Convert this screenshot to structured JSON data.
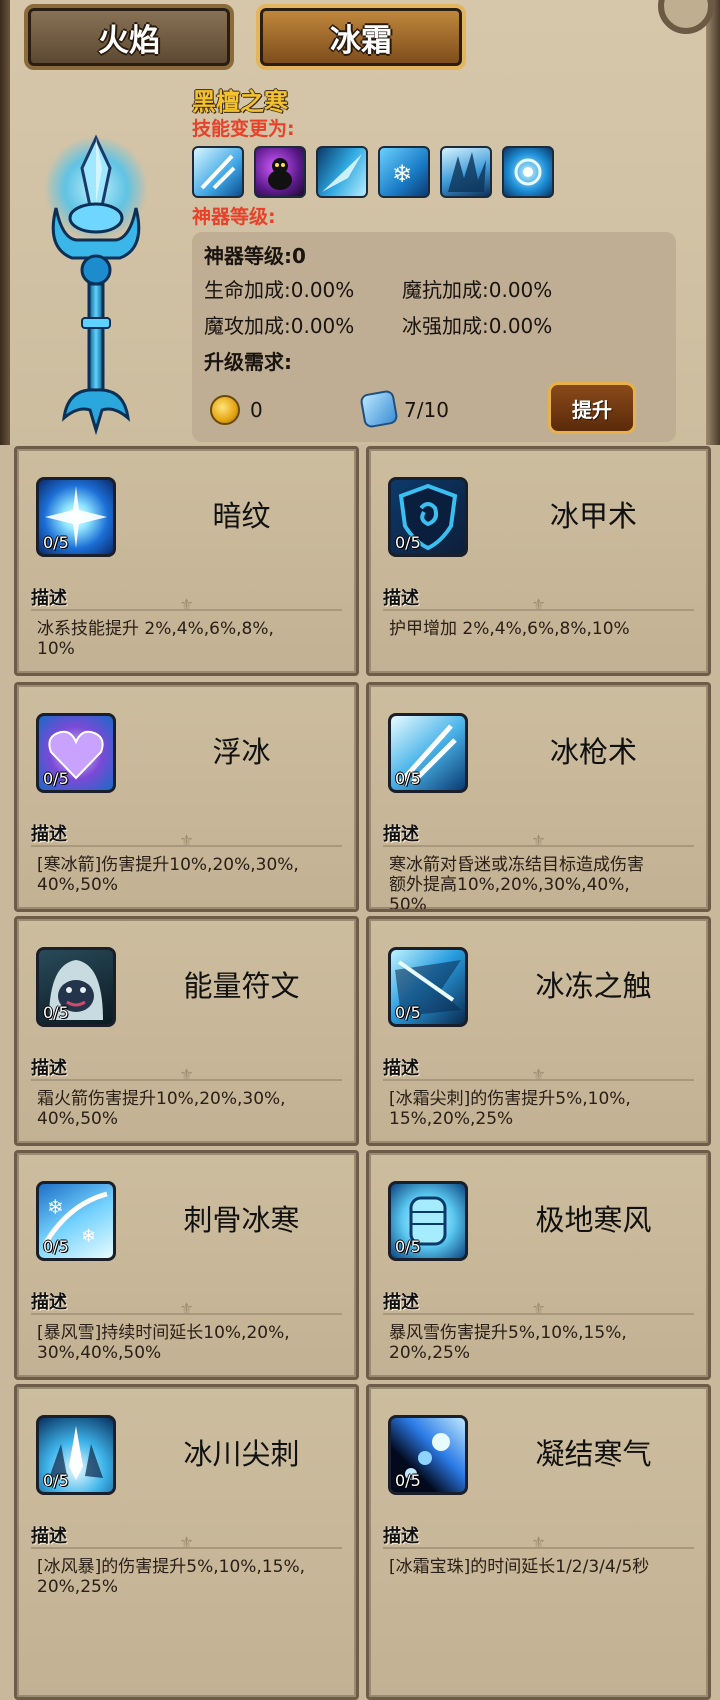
{
  "tabs": [
    {
      "label": "火焰",
      "active": false
    },
    {
      "label": "冰霜",
      "active": true
    }
  ],
  "artifact": {
    "name": "黑檀之寒",
    "skill_change_label": "技能变更为:",
    "level_label": "神器等级:",
    "changed_skill_icons": [
      "ice-spear-icon",
      "shadow-cat-icon",
      "frost-blade-icon",
      "snowflake-icon",
      "ice-shard-icon",
      "ice-orb-icon"
    ],
    "stats": {
      "level_line": "神器等级:0",
      "hp": "生命加成:0.00%",
      "magic_resist": "魔抗加成:0.00%",
      "magic_attack": "魔攻加成:0.00%",
      "ice_strength": "冰强加成:0.00%",
      "requirement_label": "升级需求:",
      "gold": "0",
      "gem": "7/10",
      "upgrade_label": "提升"
    }
  },
  "skills": [
    {
      "name": "暗纹",
      "level": "0/5",
      "desc_title": "描述",
      "desc": "冰系技能提升 2%,4%,6%,8%,\n10%",
      "icon": "ice-burst-icon"
    },
    {
      "name": "冰甲术",
      "level": "0/5",
      "desc_title": "描述",
      "desc": "护甲增加 2%,4%,6%,8%,10%",
      "icon": "ice-shield-icon"
    },
    {
      "name": "浮冰",
      "level": "0/5",
      "desc_title": "描述",
      "desc": "[寒冰箭]伤害提升10%,20%,30%,\n40%,50%",
      "icon": "frozen-heart-icon"
    },
    {
      "name": "冰枪术",
      "level": "0/5",
      "desc_title": "描述",
      "desc": "寒冰箭对昏迷或冻结目标造成伤害\n额外提高10%,20%,30%,40%,\n50%",
      "icon": "ice-lance-icon"
    },
    {
      "name": "能量符文",
      "level": "0/5",
      "desc_title": "描述",
      "desc": "霜火箭伤害提升10%,20%,30%,\n40%,50%",
      "icon": "hooded-monster-icon"
    },
    {
      "name": "冰冻之触",
      "level": "0/5",
      "desc_title": "描述",
      "desc": "[冰霜尖刺]的伤害提升5%,10%,\n15%,20%,25%",
      "icon": "frost-touch-icon"
    },
    {
      "name": "刺骨冰寒",
      "level": "0/5",
      "desc_title": "描述",
      "desc": "[暴风雪]持续时间延长10%,20%,\n30%,40%,50%",
      "icon": "blizzard-icon"
    },
    {
      "name": "极地寒风",
      "level": "0/5",
      "desc_title": "描述",
      "desc": "暴风雪伤害提升5%,10%,15%,\n20%,25%",
      "icon": "ice-fist-icon"
    },
    {
      "name": "冰川尖刺",
      "level": "0/5",
      "desc_title": "描述",
      "desc": "[冰风暴]的伤害提升5%,10%,15%,\n20%,25%",
      "icon": "glacier-spike-icon"
    },
    {
      "name": "凝结寒气",
      "level": "0/5",
      "desc_title": "描述",
      "desc": "[冰霜宝珠]的时间延长1/2/3/4/5秒",
      "icon": "frost-orb-trail-icon"
    }
  ]
}
